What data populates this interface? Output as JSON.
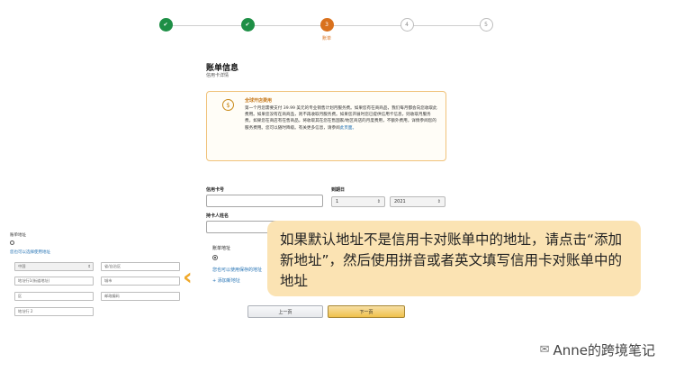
{
  "stepper": {
    "steps": [
      {
        "label": "",
        "state": "done"
      },
      {
        "label": "",
        "state": "done"
      },
      {
        "label": "账单",
        "num": "3",
        "state": "current"
      },
      {
        "label": "",
        "num": "4",
        "state": "todo"
      },
      {
        "label": "",
        "num": "5",
        "state": "todo"
      }
    ],
    "check_glyph": "✔"
  },
  "billing": {
    "title": "账单信息",
    "subtitle": "信用卡详情"
  },
  "notice": {
    "title": "全球开店费用",
    "body": "第一个月您需要支付 39.99 美元的专业销售计划月服务费。如果您有在商商品，我们每月都会向您收取此费用。如果您没有在商商品，则不再收取月服务费。如果您开展时您已提供信用卡信息，则收取月服务费。如果您在商店有在售商品，将收取其在您在售国家/地区商店的月度费用，不额外费用，详情参阅您的服务费用。您可以随时降级。有关更多信息，请参阅",
    "link": "此页面。"
  },
  "card": {
    "number_label": "信用卡号",
    "number_value": "",
    "expiry_label": "到期日",
    "month_value": "1",
    "year_value": "2021",
    "name_label": "持卡人姓名",
    "name_value": ""
  },
  "address": {
    "label": "账单地址",
    "use_saved_link": "您也可以使用保存的地址",
    "add_new_link": "+ 添加新地址"
  },
  "buttons": {
    "prev": "上一页",
    "next": "下一页"
  },
  "overlay": {
    "label": "账单地址",
    "link": "您也可以选择使用地址",
    "fields": {
      "country": "中国",
      "region": "省/自治区",
      "address1": "地址行1(街道地址)",
      "city": "城市",
      "district": "区",
      "postcode": "邮政编码",
      "address2": "地址行 2"
    }
  },
  "callout": {
    "text": "如果默认地址不是信用卡对账单中的地址，请点击“添加新地址”，然后使用拼音或者英文填写信用卡对账单中的地址"
  },
  "watermark": {
    "text": "Anne的跨境笔记",
    "icon": "wechat-icon"
  },
  "colors": {
    "accent": "#f0a92a",
    "callout_bg": "#fbe3b3",
    "done_green": "#1e8f46",
    "current_orange": "#d9711d",
    "link_blue": "#1f6fb2"
  }
}
